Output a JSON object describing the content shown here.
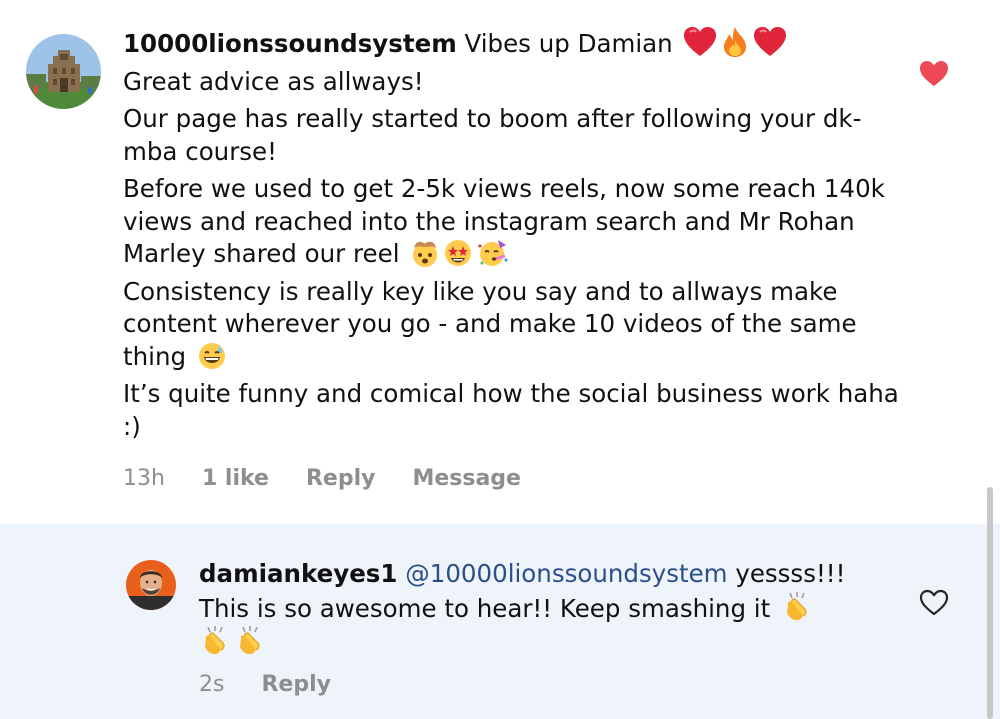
{
  "comment": {
    "username": "10000lionssoundsystem",
    "first_line": "Vibes up Damian",
    "first_line_emojis": [
      "red-heart-emoji",
      "fire-emoji",
      "red-heart-emoji"
    ],
    "lines": [
      "Great advice as allways!",
      "Our page has really started to boom after following your dk-mba course!",
      "Before we used to get 2-5k views reels, now some reach 140k views and reached into the instagram search and Mr Rohan Marley shared our reel",
      "Consistency is really key like you say and to allways make content wherever you go - and make 10 videos of the same thing",
      "It’s quite funny and comical how the social business work haha :)"
    ],
    "line3_emojis": [
      "exploding-head-emoji",
      "star-struck-emoji",
      "partying-face-emoji"
    ],
    "line4_emojis": [
      "grinning-sweat-emoji"
    ],
    "time": "13h",
    "likes": "1 like",
    "reply_label": "Reply",
    "message_label": "Message",
    "liked": true,
    "heart_color": "#ed4956"
  },
  "reply": {
    "username": "damiankeyes1",
    "mention": "@10000lionssoundsystem",
    "text_a": "yessss!!!",
    "text_b": "This is so awesome to hear!! Keep smashing it",
    "emojis": [
      "clapping-hands-emoji",
      "clapping-hands-emoji",
      "clapping-hands-emoji"
    ],
    "time": "2s",
    "reply_label": "Reply",
    "liked": false,
    "background": "#eff4fa",
    "mention_color": "#2b4e8c"
  }
}
